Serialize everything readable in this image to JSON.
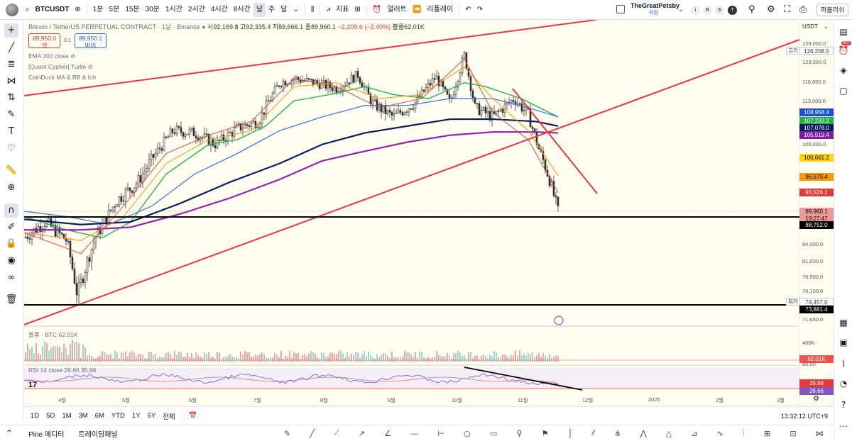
{
  "topbar": {
    "symbol": "BTCUSDT",
    "timeframes": [
      "1분",
      "5분",
      "15분",
      "30분",
      "1시간",
      "2시간",
      "4시간",
      "8시간",
      "날",
      "주",
      "달"
    ],
    "active_timeframe": "날",
    "indicators_label": "지표",
    "alert_label": "얼러트",
    "replay_label": "리플레이",
    "user_name": "TheGreatPetsby",
    "user_sub": "저장",
    "publish_label": "퍼블리쉬"
  },
  "legend": {
    "title": "Bitcoin / TetherUS PERPETUAL CONTRACT · 1날 · Binance",
    "open": "시92,169.8",
    "high": "고92,335.4",
    "low": "저89,666.1",
    "close": "종89,960.1",
    "change": "−2,209.6 (−2.40%)",
    "volume": "볼륨62.01K",
    "sell_price": "89,950.0",
    "sell_label": "셀",
    "spread": "0.1",
    "buy_price": "89,950.1",
    "buy_label": "바이"
  },
  "indicators": [
    "EMA 200 close",
    "[Quant Cypher]  Turtle",
    "ColnDuck MA & BB & Ich"
  ],
  "volume_label": "볼륨 · BTC  62.01K",
  "rsi_label": "RSI 14 close  26.66  35.96",
  "price_axis": {
    "currency": "USDT",
    "ticks": [
      "128,000.0",
      "123,000.0",
      "118,000.0",
      "113,000.0",
      "100,000.0",
      "84,000.0",
      "81,000.0",
      "78,500.0",
      "76,100.0",
      "71,650.0"
    ],
    "high_label": "고가",
    "high_value": "126,208.5",
    "low_label": "저가",
    "low_value": "74,457.0",
    "labels": [
      {
        "text": "108,958.4",
        "bg": "#1e4fd8",
        "color": "#ffffff"
      },
      {
        "text": "107,233.2",
        "bg": "#22b14c",
        "color": "#ffffff"
      },
      {
        "text": "107,078.0",
        "bg": "#0b1b5e",
        "color": "#ffffff"
      },
      {
        "text": "105,519.4",
        "bg": "#7b1fa2",
        "color": "#ffffff"
      },
      {
        "text": "100,661.2",
        "bg": "#ffd400",
        "color": "#000000"
      },
      {
        "text": "96,670.4",
        "bg": "#ff9800",
        "color": "#000000"
      },
      {
        "text": "93,526.2",
        "bg": "#e53935",
        "color": "#ffffff"
      },
      {
        "text": "89,960.1",
        "bg": "#ef9a9a",
        "color": "#000000"
      },
      {
        "text": "19:27:47",
        "bg": "#ef9a9a",
        "color": "#000000"
      },
      {
        "text": "88,752.0",
        "bg": "#000000",
        "color": "#ffffff"
      },
      {
        "text": "73,881.4",
        "bg": "#000000",
        "color": "#ffffff"
      }
    ],
    "vol_ticks": [
      "400K"
    ],
    "vol_label": "62.01K",
    "rsi_ticks": [
      "80.00"
    ],
    "rsi_values": [
      "35.96",
      "26.66"
    ]
  },
  "time_axis": [
    "4월",
    "5월",
    "6월",
    "7월",
    "8월",
    "9월",
    "10월",
    "11월",
    "12월",
    "2026",
    "2월",
    "3월"
  ],
  "bottombar": {
    "ranges": [
      "1D",
      "5D",
      "1M",
      "3M",
      "6M",
      "YTD",
      "1Y",
      "5Y",
      "전체"
    ],
    "clock": "13:32:12 UTC+9"
  },
  "footer": {
    "tabs": [
      "Pine 에디터",
      "트레이딩패널"
    ]
  },
  "colors": {
    "candle_up": "#26a69a",
    "ma_green": "#2bb24c",
    "ma_blue": "#3b6fd8",
    "ma_navy": "#0b1b5e",
    "ma_purple": "#8e24aa",
    "trend_red": "#e53945"
  },
  "chart_data": {
    "type": "line",
    "x": [
      "4월",
      "5월",
      "6월",
      "7월",
      "8월",
      "9월",
      "10월",
      "11월",
      "11월 말"
    ],
    "series": [
      {
        "values": [
          85000,
          95000,
          105000,
          108000,
          118000,
          111000,
          123000,
          108000,
          89960
        ]
      }
    ],
    "ylim": [
      71650,
      128000
    ]
  }
}
